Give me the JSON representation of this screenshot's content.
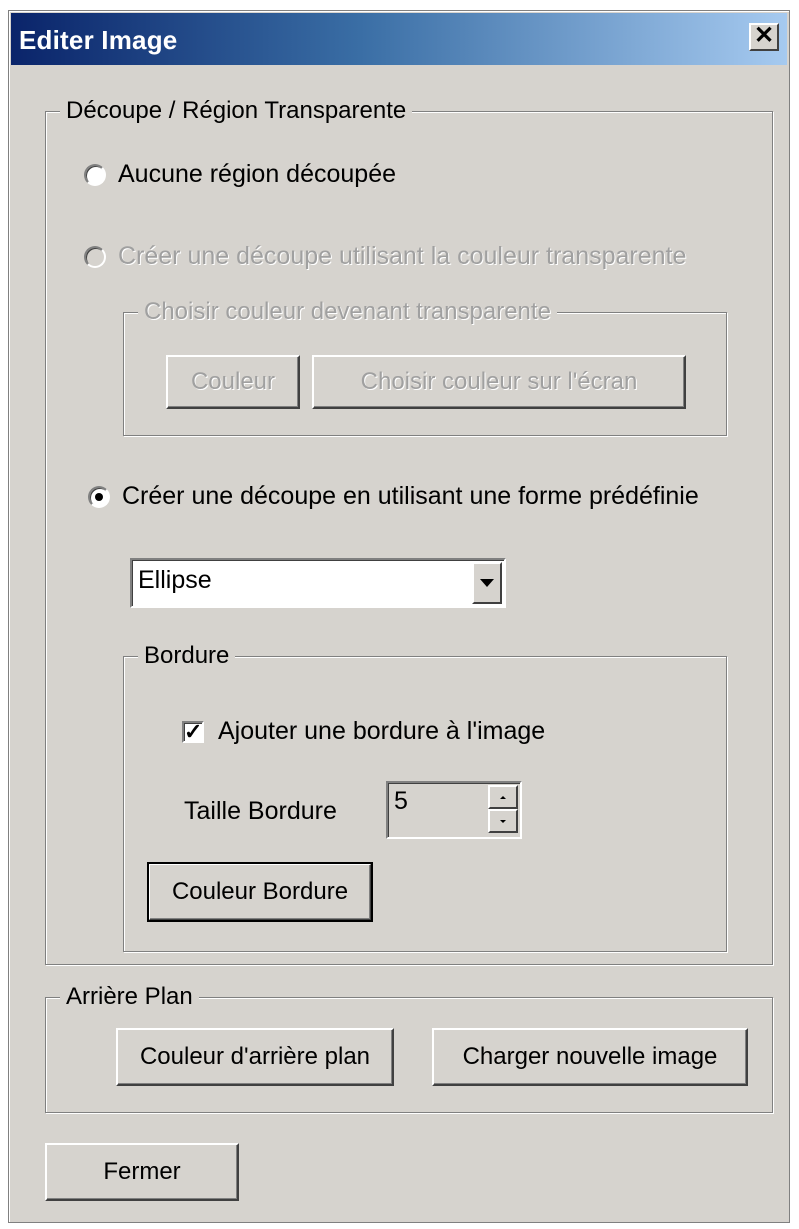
{
  "window": {
    "title": "Editer Image",
    "close_glyph": "✕"
  },
  "cutout_group": {
    "legend": "Découpe / Région Transparente",
    "option_none": "Aucune région découpée",
    "option_transparent": "Créer une découpe utilisant la couleur transparente",
    "transparent_color_group": {
      "legend": "Choisir couleur devenant transparente",
      "color_button": "Couleur",
      "pick_screen_button": "Choisir couleur sur l'écran"
    },
    "option_predefined": "Créer une découpe en utilisant une forme prédéfinie",
    "selected_option": "option_predefined",
    "shape_select": {
      "value": "Ellipse"
    },
    "border_group": {
      "legend": "Bordure",
      "add_border_label": "Ajouter une bordure à l'image",
      "add_border_checked": true,
      "size_label": "Taille Bordure",
      "size_value": "5",
      "border_color_button": "Couleur Bordure"
    }
  },
  "background_group": {
    "legend": "Arrière Plan",
    "bg_color_button": "Couleur d'arrière plan",
    "load_image_button": "Charger nouvelle image"
  },
  "close_button": "Fermer"
}
